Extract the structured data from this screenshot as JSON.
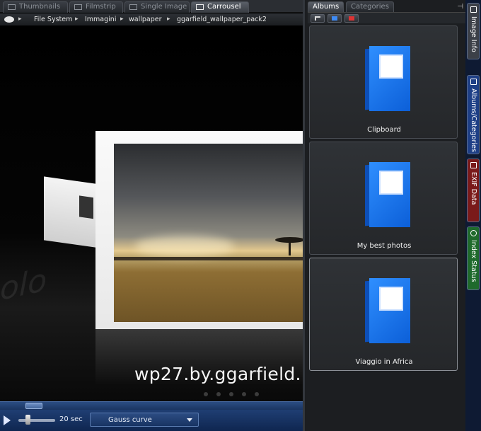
{
  "viewer_tabs": [
    {
      "label": "Thumbnails",
      "icon": "thumbnails-icon",
      "active": false
    },
    {
      "label": "Filmstrip",
      "icon": "filmstrip-icon",
      "active": false
    },
    {
      "label": "Single Image",
      "icon": "single-image-icon",
      "active": false
    },
    {
      "label": "Carrousel",
      "icon": "carrousel-icon",
      "active": true
    }
  ],
  "breadcrumb": [
    "File System",
    "Immagini",
    "wallpaper",
    "ggarfield_wallpaper_pack2"
  ],
  "viewer": {
    "caption": "wp27.by.ggarfield.",
    "ghost_text": "olo"
  },
  "controls": {
    "interval": "20 sec",
    "effect": "Gauss curve"
  },
  "albums_panel": {
    "tabs": [
      {
        "label": "Albums",
        "active": true
      },
      {
        "label": "Categories",
        "active": false
      }
    ],
    "pin": "⊣",
    "albums": [
      {
        "name": "Clipboard"
      },
      {
        "name": "My best photos"
      },
      {
        "name": "Viaggio in Africa",
        "selected": true
      }
    ],
    "colors": {
      "book": "#1f7af0"
    }
  },
  "side_tabs": [
    {
      "label": "Image Info",
      "color": "#3c4048"
    },
    {
      "label": "Albums/Categories",
      "color": "#1e3f86"
    },
    {
      "label": "EXIF Data",
      "color": "#7a1a1a"
    },
    {
      "label": "Index Status",
      "color": "#1f6a2c"
    }
  ]
}
